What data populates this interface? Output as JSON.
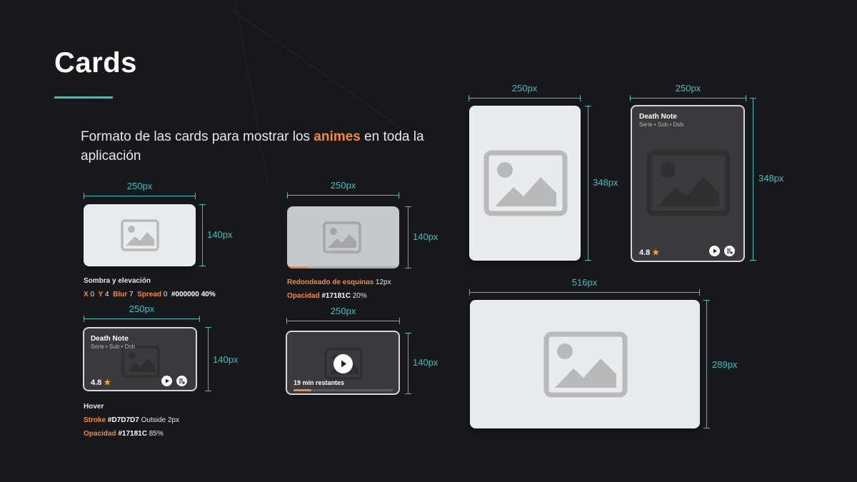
{
  "title": "Cards",
  "intro": {
    "before": "Formato de las cards para mostrar los ",
    "highlight": "animes",
    "after": " en toda la aplicación"
  },
  "dims": {
    "w250": "250px",
    "h140": "140px",
    "h348": "348px",
    "w516": "516px",
    "h289": "289px"
  },
  "shadow_spec": {
    "heading": "Sombra y elevación",
    "x_label": "X",
    "x_val": "0",
    "y_label": "Y",
    "y_val": "4",
    "blur_label": "Blur",
    "blur_val": "7",
    "spread_label": "Spread",
    "spread_val": "0",
    "color": "#000000 40%"
  },
  "radius_spec": {
    "label": "Redondeado de esquinas",
    "value": "12px",
    "opacity_label": "Opacidad",
    "opacity_color": "#17181C",
    "opacity_val": "20%"
  },
  "hover_spec": {
    "heading": "Hover",
    "stroke_label": "Stroke",
    "stroke_color": "#D7D7D7",
    "stroke_val": "Outside 2px",
    "opacity_label": "Opacidad",
    "opacity_color": "#17181C",
    "opacity_val": "85%"
  },
  "card_info": {
    "title": "Death Note",
    "subtitle": "Serie • Sub • Dob",
    "rating": "4.8",
    "star": "★"
  },
  "continue_card": {
    "label": "19 min restantes",
    "progress": 0.18
  },
  "colors": {
    "accent": "#35c2c2",
    "highlight": "#f58a33",
    "stroke": "#D7D7D7",
    "background": "#17181C"
  },
  "icons": {
    "image": "image-placeholder-icon",
    "play": "play-icon",
    "add_list": "add-to-list-icon",
    "star": "star-icon"
  }
}
